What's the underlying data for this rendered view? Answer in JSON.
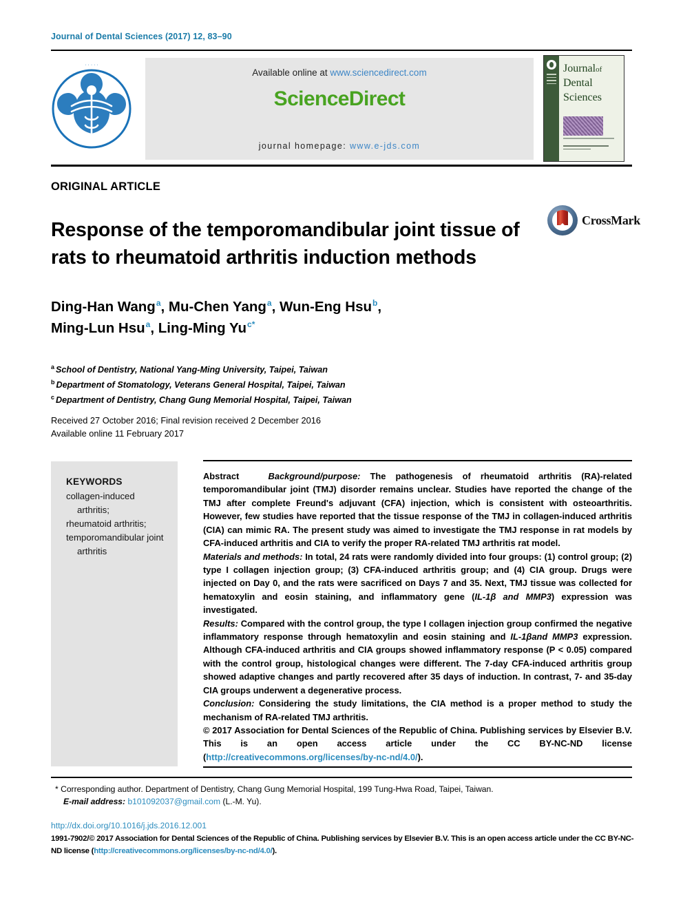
{
  "running_head": "Journal of Dental Sciences (2017) 12, 83–90",
  "header": {
    "available_online_prefix": "Available online at ",
    "sciencedirect_url": "www.sciencedirect.com",
    "sciencedirect_wordmark": "ScienceDirect",
    "homepage_prefix": "journal homepage: ",
    "homepage_url": "www.e-jds.com",
    "society_logo_alt": "society-emblem",
    "cover": {
      "line1": "Journal",
      "line1_small": "of",
      "line2": "Dental",
      "line3": "Sciences"
    }
  },
  "article": {
    "type": "ORIGINAL ARTICLE",
    "title": "Response of the temporomandibular joint tissue of rats to rheumatoid arthritis induction methods",
    "crossmark_label": "CrossMark",
    "authors": [
      {
        "name": "Ding-Han Wang",
        "sup": "a",
        "sep": ", "
      },
      {
        "name": "Mu-Chen Yang",
        "sup": "a",
        "sep": ", "
      },
      {
        "name": "Wun-Eng Hsu",
        "sup": "b",
        "sep": ","
      },
      {
        "name": "Ming-Lun Hsu",
        "sup": "a",
        "sep": ", "
      },
      {
        "name": "Ling-Ming Yu",
        "sup": "c*",
        "sep": ""
      }
    ],
    "affiliations": [
      {
        "marker": "a",
        "text": "School of Dentistry, National Yang-Ming University, Taipei, Taiwan"
      },
      {
        "marker": "b",
        "text": "Department of Stomatology, Veterans General Hospital, Taipei, Taiwan"
      },
      {
        "marker": "c",
        "text": "Department of Dentistry, Chang Gung Memorial Hospital, Taipei, Taiwan"
      }
    ],
    "dates_line1": "Received 27 October 2016; Final revision received 2 December 2016",
    "dates_line2": "Available online 11 February 2017"
  },
  "keywords": {
    "title": "KEYWORDS",
    "items": [
      "collagen-induced arthritis;",
      "rheumatoid arthritis;",
      "temporomandibular joint arthritis"
    ]
  },
  "abstract": {
    "label": "Abstract",
    "background_label": "Background/purpose:",
    "background_text": " The pathogenesis of rheumatoid arthritis (RA)-related temporomandibular joint (TMJ) disorder remains unclear. Studies have reported the change of the TMJ after complete Freund's adjuvant (CFA) injection, which is consistent with osteoarthritis. However, few studies have reported that the tissue response of the TMJ in collagen-induced arthritis (CIA) can mimic RA. The present study was aimed to investigate the TMJ response in rat models by CFA-induced arthritis and CIA to verify the proper RA-related TMJ arthritis rat model.",
    "methods_label": "Materials and methods:",
    "methods_text_1": " In total, 24 rats were randomly divided into four groups: (1) control group; (2) type I collagen injection group; (3) CFA-induced arthritis group; and (4) CIA group. Drugs were injected on Day 0, and the rats were sacrificed on Days 7 and 35. Next, TMJ tissue was collected for hematoxylin and eosin staining, and inflammatory gene (",
    "methods_gene_1": "IL-1β and MMP3",
    "methods_text_2": ") expression was investigated.",
    "results_label": "Results:",
    "results_text_1": " Compared with the control group, the type I collagen injection group confirmed the negative inflammatory response through hematoxylin and eosin staining and ",
    "results_gene_1": "IL-1βand MMP3",
    "results_text_2": " expression. Although CFA-induced arthritis and CIA groups showed inflammatory response (P < 0.05) compared with the control group, histological changes were different. The 7-day CFA-induced arthritis group showed adaptive changes and partly recovered after 35 days of induction. In contrast, 7- and 35-day CIA groups underwent a degenerative process.",
    "conclusion_label": "Conclusion:",
    "conclusion_text": " Considering the study limitations, the CIA method is a proper method to study the mechanism of RA-related TMJ arthritis.",
    "copyright_text": "© 2017 Association for Dental Sciences of the Republic of China. Publishing services by Elsevier B.V. This is an open access article under the CC BY-NC-ND license (",
    "copyright_url": "http://creativecommons.org/licenses/by-nc-nd/4.0/",
    "copyright_tail": ")."
  },
  "footer": {
    "corresponding_marker": "*",
    "corresponding_text": " Corresponding author. Department of Dentistry, Chang Gung Memorial Hospital, 199 Tung-Hwa Road, Taipei, Taiwan.",
    "email_label": "E-mail address:",
    "email": "b101092037@gmail.com",
    "email_suffix": " (L.-M. Yu).",
    "doi": "http://dx.doi.org/10.1016/j.jds.2016.12.001",
    "legal_prefix": "1991-7902/© 2017 Association for Dental Sciences of the Republic of China. Publishing services by Elsevier B.V. This is an open access article under the CC BY-NC-ND license (",
    "legal_url": "http://creativecommons.org/licenses/by-nc-nd/4.0/",
    "legal_tail": ")."
  },
  "colors": {
    "running_head": "#1a7ba8",
    "link": "#2b8cbe",
    "sciencedirect_green": "#48a320",
    "sd_band": "#e6e6e6",
    "keyword_box": "#e3e3e3",
    "cover_green": "#3c5a39"
  }
}
